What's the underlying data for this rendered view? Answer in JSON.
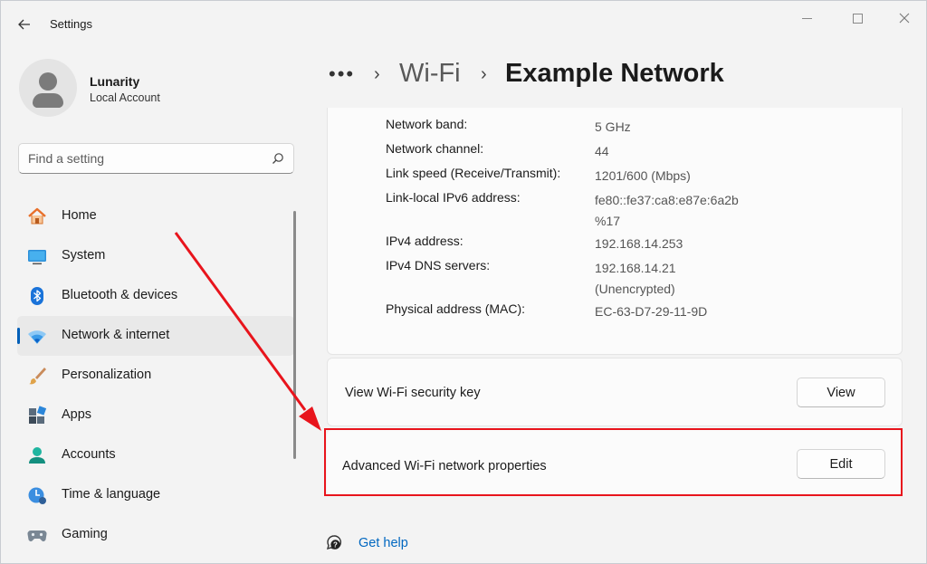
{
  "window": {
    "title": "Settings",
    "back_icon": "back-arrow-icon"
  },
  "profile": {
    "name": "Lunarity",
    "account_type": "Local Account"
  },
  "search": {
    "placeholder": "Find a setting",
    "value": ""
  },
  "sidebar": {
    "active_index": 3,
    "items": [
      {
        "label": "Home",
        "icon": "home-icon"
      },
      {
        "label": "System",
        "icon": "system-icon"
      },
      {
        "label": "Bluetooth & devices",
        "icon": "bluetooth-icon"
      },
      {
        "label": "Network & internet",
        "icon": "wifi-icon"
      },
      {
        "label": "Personalization",
        "icon": "brush-icon"
      },
      {
        "label": "Apps",
        "icon": "apps-icon"
      },
      {
        "label": "Accounts",
        "icon": "accounts-icon"
      },
      {
        "label": "Time & language",
        "icon": "time-language-icon"
      },
      {
        "label": "Gaming",
        "icon": "gaming-icon"
      }
    ]
  },
  "breadcrumb": {
    "more": "•••",
    "parent": "Wi-Fi",
    "current": "Example Network"
  },
  "properties": [
    {
      "label": "Network band:",
      "value": "5 GHz",
      "value2": ""
    },
    {
      "label": "Network channel:",
      "value": "44",
      "value2": ""
    },
    {
      "label": "Link speed (Receive/Transmit):",
      "value": "1201/600 (Mbps)",
      "value2": ""
    },
    {
      "label": "Link-local IPv6 address:",
      "value": "fe80::fe37:ca8:e87e:6a2b",
      "value2": "%17"
    },
    {
      "label": "IPv4 address:",
      "value": "192.168.14.253",
      "value2": ""
    },
    {
      "label": "IPv4 DNS servers:",
      "value": "192.168.14.21",
      "value2": "(Unencrypted)"
    },
    {
      "label": "Physical address (MAC):",
      "value": "EC-63-D7-29-11-9D",
      "value2": ""
    }
  ],
  "security_key": {
    "label": "View Wi-Fi security key",
    "button": "View"
  },
  "advanced": {
    "label": "Advanced Wi-Fi network properties",
    "button": "Edit"
  },
  "help": {
    "label": "Get help"
  },
  "colors": {
    "accent": "#005fb8",
    "highlight": "#e8141c",
    "link": "#0067c0"
  }
}
